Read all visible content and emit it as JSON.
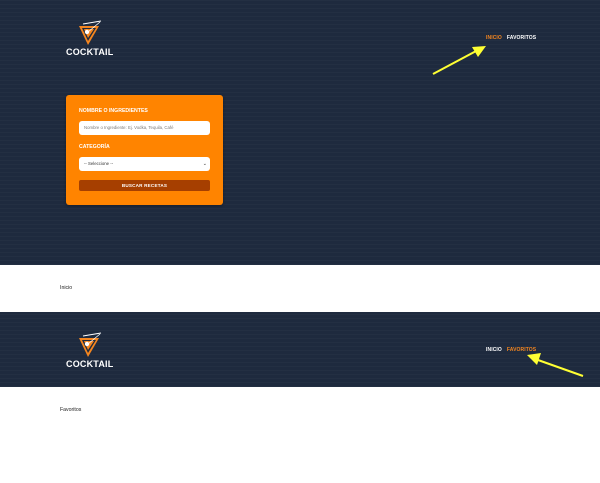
{
  "brand": {
    "logo_text": "COCKTAIL",
    "accent_color": "#f5861f",
    "header_bg": "#1e2a3e",
    "card_bg": "#ff8400",
    "button_bg": "#a63f00",
    "arrow_color": "#ffff33"
  },
  "nav": {
    "home_label": "INICIO",
    "favorites_label": "FAVORITOS"
  },
  "search": {
    "name_label": "NOMBRE O INGREDIENTES",
    "name_placeholder": "Nombre o Ingrediente: Ej. Vodka, Tequila, Café",
    "category_label": "CATEGORÍA",
    "category_selected": "-- Seleccione --",
    "submit_label": "BUSCAR RECETAS"
  },
  "page1": {
    "content_text": "Inicio"
  },
  "page2": {
    "content_text": "Favoritos"
  },
  "icons": {
    "logo": "cocktail-glass-icon",
    "arrow": "annotation-arrow-icon",
    "select": "chevron-down-icon"
  }
}
